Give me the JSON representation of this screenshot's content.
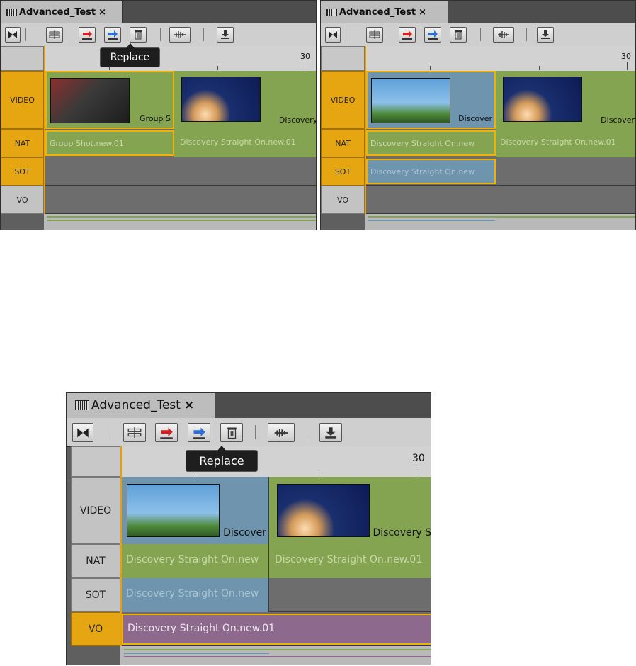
{
  "panels": [
    {
      "tab_title": "Advanced_Test",
      "tab_close": "×",
      "tooltip": "Replace",
      "ruler_mark": "30",
      "tracks": [
        {
          "label": "VIDEO",
          "active": true
        },
        {
          "label": "NAT",
          "active": true
        },
        {
          "label": "SOT",
          "active": true
        },
        {
          "label": "VO",
          "active": false
        }
      ],
      "video_clips": [
        {
          "name": "Group S",
          "thumb": "group-shot"
        },
        {
          "name": "Discovery St",
          "thumb": "shuttle-launch"
        }
      ],
      "nat_clips": [
        "Group Shot.new.01",
        "Discovery Straight On.new.01"
      ],
      "sot_clips": [],
      "vo_clips": []
    },
    {
      "tab_title": "Advanced_Test",
      "tab_close": "×",
      "ruler_mark": "30",
      "tracks": [
        {
          "label": "VIDEO",
          "active": true
        },
        {
          "label": "NAT",
          "active": true
        },
        {
          "label": "SOT",
          "active": true
        },
        {
          "label": "VO",
          "active": false
        }
      ],
      "video_clips": [
        {
          "name": "Discover",
          "thumb": "shuttle-pad"
        },
        {
          "name": "Discovery S",
          "thumb": "shuttle-launch"
        }
      ],
      "nat_clips": [
        "Discovery Straight On.new",
        "Discovery Straight On.new.01"
      ],
      "sot_clips": [
        "Discovery Straight On.new"
      ],
      "vo_clips": []
    },
    {
      "tab_title": "Advanced_Test",
      "tab_close": "×",
      "tooltip": "Replace",
      "ruler_mark": "30",
      "tracks": [
        {
          "label": "VIDEO",
          "active": false
        },
        {
          "label": "NAT",
          "active": false
        },
        {
          "label": "SOT",
          "active": false
        },
        {
          "label": "VO",
          "active": true
        }
      ],
      "video_clips": [
        {
          "name": "Discover",
          "thumb": "shuttle-pad"
        },
        {
          "name": "Discovery S",
          "thumb": "shuttle-launch"
        }
      ],
      "nat_clips": [
        "Discovery Straight On.new",
        "Discovery Straight On.new.01"
      ],
      "sot_clips": [
        "Discovery Straight On.new"
      ],
      "vo_clips": [
        "Discovery Straight On.new.01"
      ]
    }
  ],
  "toolbar_icons": [
    "bowtie-icon",
    "split-clip-icon",
    "insert-icon",
    "replace-icon",
    "delete-icon",
    "audio-waveform-icon",
    "download-icon"
  ],
  "colors": {
    "accent": "#e6a611",
    "clip_green": "#85a452",
    "clip_blue": "#6e95ad",
    "clip_purple": "#8d6a8d"
  }
}
